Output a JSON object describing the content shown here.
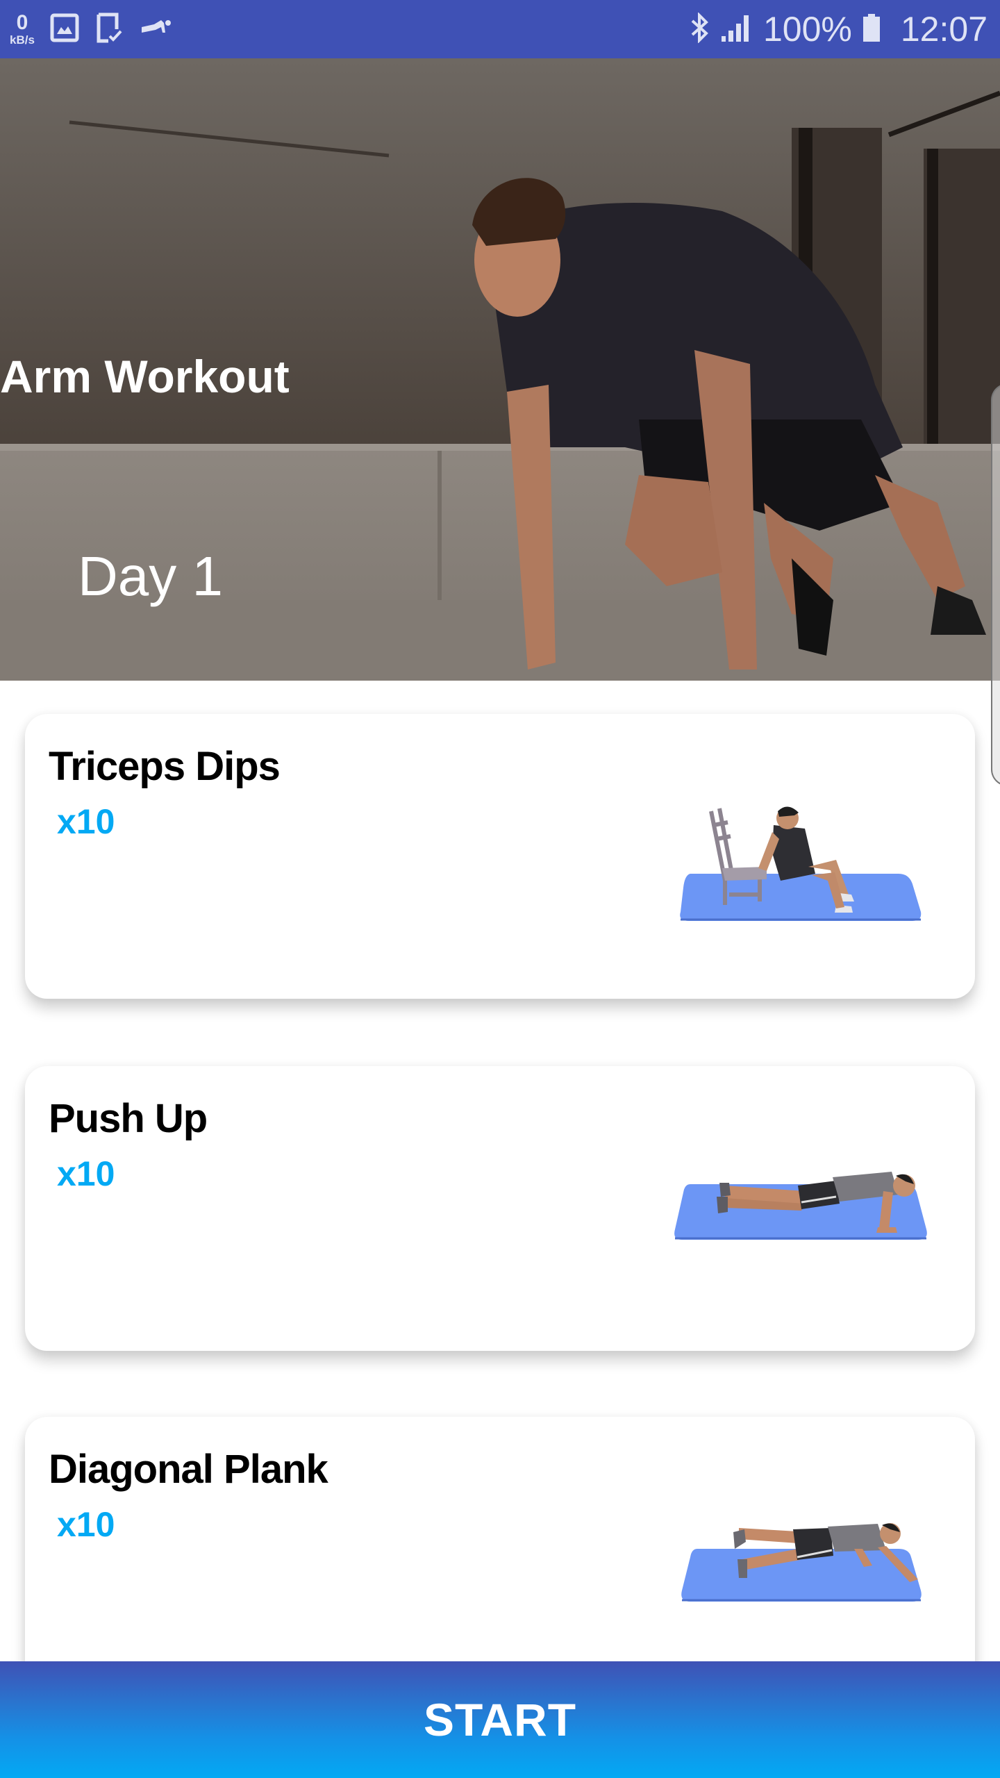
{
  "status_bar": {
    "net_speed_value": "0",
    "net_speed_unit": "kB/s",
    "left_icons": [
      "gallery-icon",
      "tablet-check-icon",
      "pushup-app-icon"
    ],
    "right_icons": [
      "bluetooth-icon",
      "signal-icon",
      "battery-icon"
    ],
    "battery_percent": "100%",
    "time": "12:07"
  },
  "hero": {
    "title": "Arm Workout",
    "day_label": "Day 1",
    "image_semantic": "man-doing-mountain-climbers-photo"
  },
  "exercises": [
    {
      "name": "Triceps Dips",
      "reps": "x10",
      "illustration": "triceps-dips-illustration"
    },
    {
      "name": "Push Up",
      "reps": "x10",
      "illustration": "push-up-illustration"
    },
    {
      "name": "Diagonal Plank",
      "reps": "x10",
      "illustration": "diagonal-plank-illustration"
    }
  ],
  "footer": {
    "start_label": "START"
  },
  "colors": {
    "status_bar": "#3F51B5",
    "reps_accent": "#03A9F4",
    "mat_blue": "#6C96F5",
    "button_gradient_top": "#3F51B5",
    "button_gradient_bottom": "#03A9F4"
  }
}
